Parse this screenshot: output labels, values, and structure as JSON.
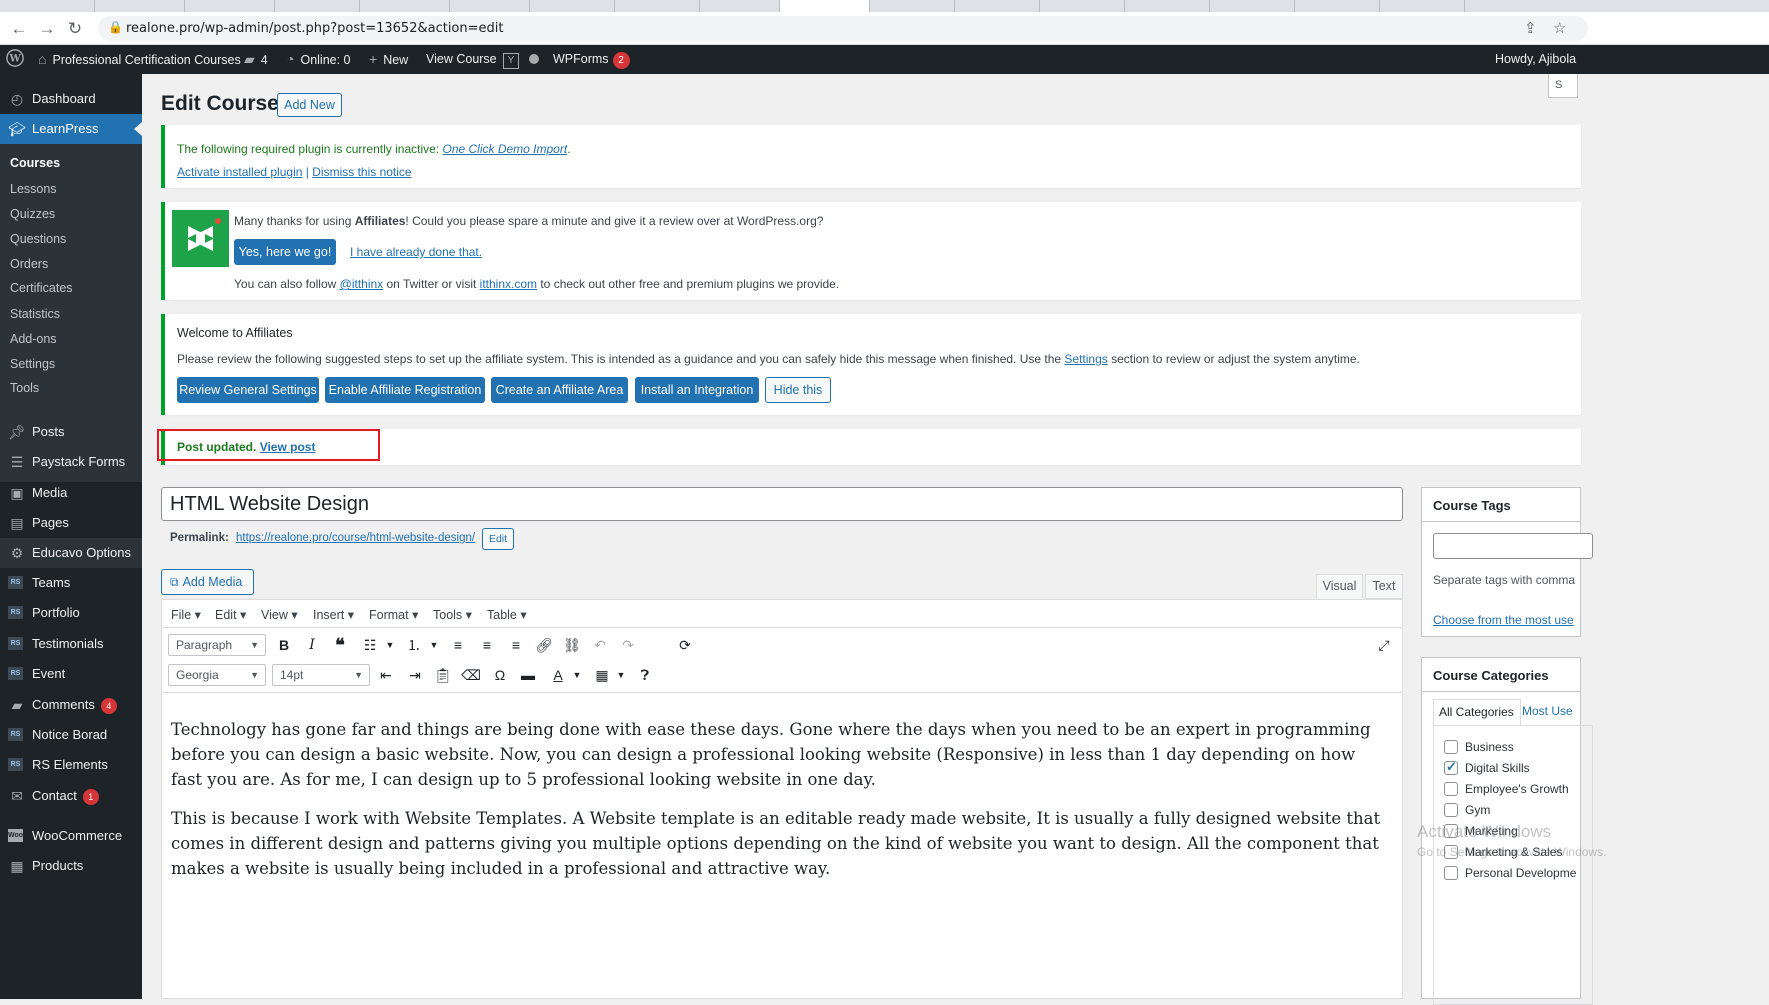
{
  "browser": {
    "url": "realone.pro/wp-admin/post.php?post=13652&action=edit"
  },
  "adminbar": {
    "site_name": "Professional Certification Courses",
    "comments_count": "4",
    "online": "Online: 0",
    "new": "New",
    "view_course": "View Course",
    "wpforms": "WPForms",
    "wpforms_badge": "2",
    "howdy": "Howdy, Ajibola"
  },
  "sidebar": {
    "dashboard": "Dashboard",
    "learnpress": "LearnPress",
    "sub": [
      "Courses",
      "Lessons",
      "Quizzes",
      "Questions",
      "Orders",
      "Certificates",
      "Statistics",
      "Add-ons",
      "Settings",
      "Tools"
    ],
    "items": [
      "Posts",
      "Paystack Forms",
      "Media",
      "Pages",
      "Educavo Options",
      "Teams",
      "Portfolio",
      "Testimonials",
      "Event",
      "Comments",
      "Notice Borad",
      "RS Elements",
      "Contact",
      "WooCommerce",
      "Products"
    ],
    "comments_badge": "4",
    "contact_badge": "1"
  },
  "header": {
    "title": "Edit Course",
    "add_new": "Add New",
    "screen_options": "S"
  },
  "notice_plugin": {
    "text": "The following required plugin is currently inactive:",
    "plugin_link": "One Click Demo Import",
    "period": ".",
    "activate": "Activate installed plugin",
    "sep": "|",
    "dismiss": "Dismiss this notice"
  },
  "notice_review": {
    "text_pre": "Many thanks for using ",
    "text_bold": "Affiliates",
    "text_post": "! Could you please spare a minute and give it a review over at WordPress.org?",
    "yes_btn": "Yes, here we go!",
    "done_link": "I have already done that.",
    "follow_pre": "You can also follow ",
    "twitter": "@itthinx",
    "follow_mid": " on Twitter or visit ",
    "site": "itthinx.com",
    "follow_post": " to check out other free and premium plugins we provide."
  },
  "notice_welcome": {
    "title": "Welcome to Affiliates",
    "text_pre": "Please review the following suggested steps to set up the affiliate system. This is intended as a guidance and you can safely hide this message when finished. Use the ",
    "settings_link": "Settings",
    "text_post": " section to review or adjust the system anytime.",
    "buttons": [
      "Review General Settings",
      "Enable Affiliate Registration",
      "Create an Affiliate Area",
      "Install an Integration"
    ],
    "hide": "Hide this"
  },
  "notice_updated": {
    "text": "Post updated.",
    "link": "View post"
  },
  "editor": {
    "post_title": "HTML Website Design",
    "permalink_label": "Permalink:",
    "permalink_url": "https://realone.pro/course/html-website-design/",
    "edit_btn": "Edit",
    "add_media": "Add Media",
    "tab_visual": "Visual",
    "tab_text": "Text",
    "menu": [
      "File",
      "Edit",
      "View",
      "Insert",
      "Format",
      "Tools",
      "Table"
    ],
    "format_select": "Paragraph",
    "font_select": "Georgia",
    "size_select": "14pt",
    "paragraphs": [
      "Technology has gone far and things are being done with ease these days. Gone where the days when you need to be an expert in programming before you can design a basic website. Now, you can design a professional looking website (Responsive) in less than 1 day depending on how fast you are. As for me, I can design up to 5 professional looking website in one day.",
      "This is because I work with Website Templates. A Website template is an editable ready made website, It is usually a fully designed website that comes in different design and patterns giving you multiple options depending on the kind of website you want to design. All the component that makes a website is usually being included in a professional and attractive way."
    ]
  },
  "course_tags": {
    "title": "Course Tags",
    "hint": "Separate tags with comma",
    "choose": "Choose from the most use"
  },
  "course_categories": {
    "title": "Course Categories",
    "tab_all": "All Categories",
    "tab_most": "Most Use",
    "items": [
      {
        "label": "Business",
        "checked": false
      },
      {
        "label": "Digital Skills",
        "checked": true
      },
      {
        "label": "Employee's Growth",
        "checked": false
      },
      {
        "label": "Gym",
        "checked": false
      },
      {
        "label": "Marketing",
        "checked": false
      },
      {
        "label": "Marketing & Sales",
        "checked": false
      },
      {
        "label": "Personal Developme",
        "checked": false
      }
    ]
  },
  "watermark": {
    "line1": "Activate Windows",
    "line2": "Go to Settings to activate Windows."
  }
}
